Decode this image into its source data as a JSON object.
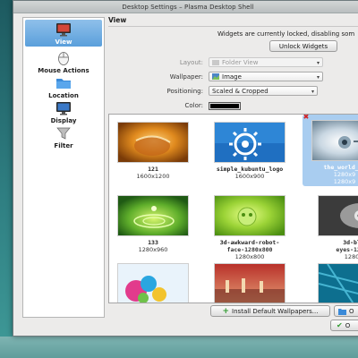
{
  "window": {
    "title": "Desktop Settings – Plasma Desktop Shell"
  },
  "sidebar": {
    "items": [
      {
        "label": "View",
        "icon": "monitor-view-icon",
        "selected": true
      },
      {
        "label": "Mouse Actions",
        "icon": "mouse-icon",
        "selected": false
      },
      {
        "label": "Location",
        "icon": "folder-icon",
        "selected": false
      },
      {
        "label": "Display",
        "icon": "display-icon",
        "selected": false
      },
      {
        "label": "Filter",
        "icon": "funnel-icon",
        "selected": false
      }
    ]
  },
  "main": {
    "header": "View",
    "lock_message": "Widgets are currently locked, disabling som",
    "unlock_button": "Unlock Widgets",
    "layout": {
      "label": "Layout:",
      "value": "Folder View"
    },
    "wallpaper": {
      "label": "Wallpaper:",
      "value": "Image"
    },
    "positioning": {
      "label": "Positioning:",
      "value": "Scaled & Cropped"
    },
    "color": {
      "label": "Color:",
      "value": "#000000"
    }
  },
  "wallpapers": [
    {
      "name": "121",
      "resolution": "1600x1200",
      "selected": false
    },
    {
      "name": "simple_kubuntu_logo",
      "resolution": "1600x900",
      "selected": false
    },
    {
      "name": "the_world_is",
      "name2": "1280x9",
      "resolution": "1280x9",
      "selected": true
    },
    {
      "name": "133",
      "resolution": "1280x960",
      "selected": false
    },
    {
      "name": "3d-awkward-robot-",
      "name2": "face-1280x800",
      "resolution": "1280x800",
      "selected": false
    },
    {
      "name": "3d-blu",
      "name2": "eyes-1280x",
      "resolution": "1280x",
      "selected": false
    }
  ],
  "footer": {
    "install_button": "Install Default Wallpapers...",
    "open_button": "O",
    "ok_button": "O"
  },
  "colors": {
    "accent": "#5a9fdb",
    "selection": "#a9cdf0"
  }
}
